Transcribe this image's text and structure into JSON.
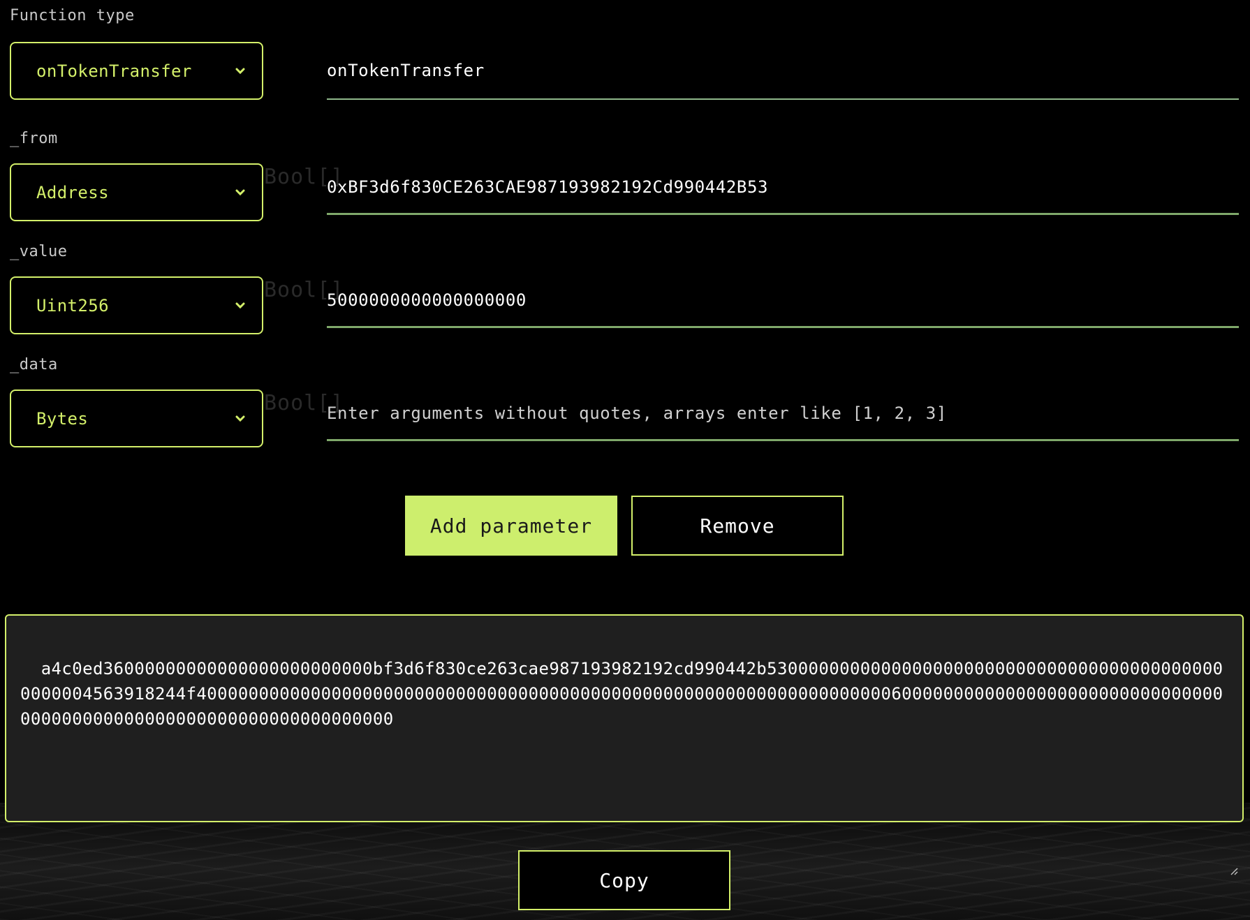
{
  "function_type": {
    "label": "Function type",
    "selected": "onTokenTransfer",
    "name_value": "onTokenTransfer"
  },
  "params": [
    {
      "label": "_from",
      "type": "Address",
      "ghost": "Bool[]",
      "value": "0xBF3d6f830CE263CAE987193982192Cd990442B53"
    },
    {
      "label": "_value",
      "type": "Uint256",
      "ghost": "Bool[]",
      "value": "5000000000000000000"
    },
    {
      "label": "_data",
      "type": "Bytes",
      "ghost": "Bool[]",
      "value": "",
      "placeholder": "Enter arguments without quotes, arrays enter like [1, 2, 3]"
    }
  ],
  "buttons": {
    "add_parameter": "Add parameter",
    "remove": "Remove",
    "copy": "Copy"
  },
  "output": {
    "encoded": "a4c0ed36000000000000000000000000bf3d6f830ce263cae987193982192cd990442b530000000000000000000000000000000000000000000000004563918244f400000000000000000000000000000000000000000000000000000000000000000060000000000000000000000000000000000000000000000000000000000000000000"
  },
  "colors": {
    "accent": "#d4f06a",
    "accent_fill": "#cdee6d",
    "underline": "#7fa86a",
    "panel": "#1f1f1f"
  },
  "icons": [
    "chevron-down-icon",
    "resize-handle-icon"
  ]
}
